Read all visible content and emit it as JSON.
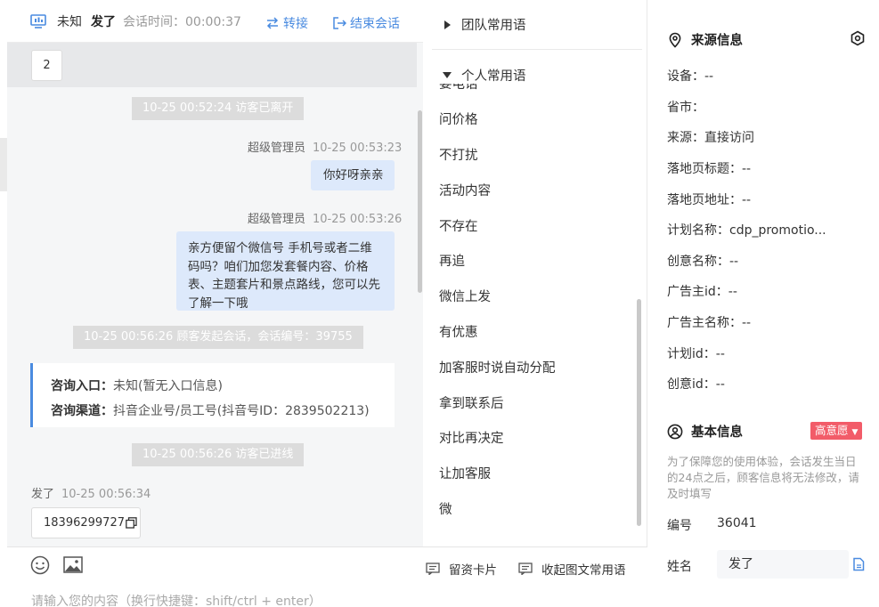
{
  "header": {
    "status": "未知",
    "visitor_name": "发了",
    "session_time_label": "会话时间：",
    "session_time": "00:00:37",
    "transfer_label": "转接",
    "end_label": "结束会话"
  },
  "chat": {
    "top_card_value": "2",
    "messages": {
      "sys_left": "10-25 00:52:24 访客已离开",
      "msg1_sender": "超级管理员",
      "msg1_time": "10-25 00:53:23",
      "msg1_text": "你好呀亲亲",
      "msg2_sender": "超级管理员",
      "msg2_time": "10-25 00:53:26",
      "msg2_line1": "亲方便留个微信号 手机号或者二维",
      "msg2_line2": "码吗？咱们加您发套餐内容、价格",
      "msg2_line3": "表、主题套片和景点路线，您可以先",
      "msg2_line4": "了解一下哦",
      "sys_session": "10-25 00:56:26 顾客发起会话，会话编号：39755",
      "entry_label": "咨询入口：",
      "entry_value": "未知(暂无入口信息)",
      "channel_label": "咨询渠道：",
      "channel_value": "抖音企业号/员工号(抖音号ID：2839502213)",
      "sys_entered": "10-25 00:56:26 访客已进线",
      "visitor_sender": "发了",
      "visitor_time": "10-25 00:56:34",
      "visitor_phone": "18396299727"
    },
    "input_placeholder": "请输入您的内容（换行快捷键：shift/ctrl + enter）"
  },
  "phrases": {
    "team_group": "团队常用语",
    "personal_group": "个人常用语",
    "items": [
      "要电话",
      "问价格",
      "不打扰",
      "活动内容",
      "不存在",
      "再追",
      "微信上发",
      "有优惠",
      "加客服时说自动分配",
      "拿到联系后",
      "对比再决定",
      "让加客服",
      "微"
    ],
    "card_button": "留资卡片",
    "collapse_button": "收起图文常用语"
  },
  "source_info": {
    "title": "来源信息",
    "rows": [
      "设备：--",
      "省市：",
      "来源：直接访问",
      "落地页标题：--",
      "落地页地址：--",
      "计划名称：cdp_promotio...",
      "创意名称：--",
      "广告主id：--",
      "广告主名称：--",
      "计划id：--",
      "创意id：--"
    ]
  },
  "basic_info": {
    "title": "基本信息",
    "intent_badge": "高意愿",
    "note": "为了保障您的使用体验，会话发生当日的24点之后，顾客信息将无法修改，请及时填写",
    "id_label": "编号",
    "id_value": "36041",
    "name_label": "姓名",
    "name_value": "发了"
  },
  "colors": {
    "accent": "#4a8be0",
    "bubble": "#dde9fb",
    "badge": "#f25c69",
    "system_pill": "#dcdcdc"
  }
}
